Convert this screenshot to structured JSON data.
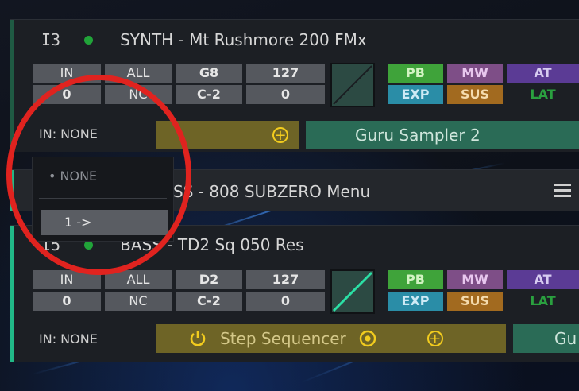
{
  "tracks": [
    {
      "number": "I3",
      "title": "SYNTH - Mt Rushmore 200 FMx",
      "grid_top": [
        "IN",
        "ALL",
        "G8",
        "127"
      ],
      "grid_bottom": [
        "0",
        "NC",
        "C-2",
        "0"
      ],
      "buttons_top": [
        "PB",
        "MW",
        "AT"
      ],
      "buttons_bottom": [
        "EXP",
        "SUS",
        "LAT"
      ],
      "in_label": "IN: NONE",
      "slot_name": "Guru Sampler 2"
    },
    {
      "title_partial": "SS - 808 SUBZERO Menu"
    },
    {
      "number": "I5",
      "title": "BASS - TD2 Sq 050 Res",
      "grid_top": [
        "IN",
        "ALL",
        "D2",
        "127"
      ],
      "grid_bottom": [
        "0",
        "NC",
        "C-2",
        "0"
      ],
      "buttons_top": [
        "PB",
        "MW",
        "AT"
      ],
      "buttons_bottom": [
        "EXP",
        "SUS",
        "LAT"
      ],
      "in_label": "IN: NONE",
      "slot_name": "Step Sequencer",
      "slot_next": "Gu"
    }
  ],
  "dropdown": {
    "options": [
      "• NONE",
      "1 ->"
    ]
  },
  "colors": {
    "accent_green": "#21b887",
    "pb": "#3fa33a",
    "mw": "#7e4e87",
    "at": "#5b3b95",
    "exp": "#2a8da7",
    "sus": "#a26a1f",
    "slot_yellow": "#6e6426",
    "slot_teal": "#2a6b56",
    "highlight_ring": "#e0231f"
  },
  "icons": {
    "add": "plus-circle-icon",
    "power": "power-icon",
    "target": "target-icon",
    "menu": "hamburger-menu-icon"
  }
}
